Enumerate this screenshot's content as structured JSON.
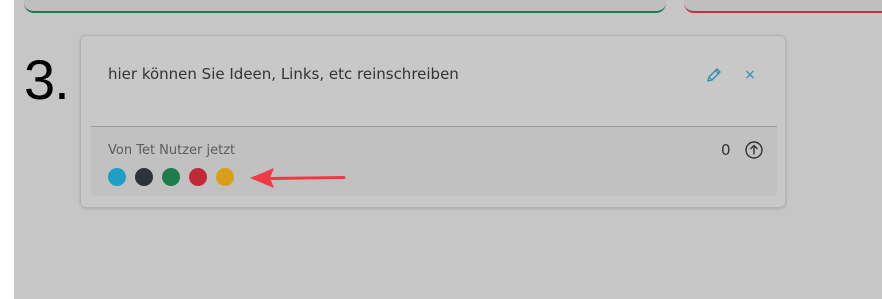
{
  "step": {
    "number": "3."
  },
  "card": {
    "text": "hier können Sie Ideen, Links, etc reinschreiben",
    "edit_icon": "pencil-icon",
    "close_icon": "close-icon",
    "close_glyph": "×",
    "footer": {
      "author": "Von Tet Nutzer jetzt",
      "vote_count": "0",
      "upvote_icon": "arrow-up-circle-icon"
    },
    "colors": [
      {
        "name": "cyan",
        "hex": "#1d9fc6"
      },
      {
        "name": "dark",
        "hex": "#2f3338"
      },
      {
        "name": "green",
        "hex": "#1c7c4c"
      },
      {
        "name": "red",
        "hex": "#c02a38"
      },
      {
        "name": "yellow",
        "hex": "#d8a017"
      }
    ]
  },
  "annotation": {
    "arrow_color": "#f03a47"
  },
  "theme": {
    "accent": "#2a8fb5",
    "top_left_card_border": "#1e7a4e",
    "top_right_card_border": "#c4303e"
  }
}
